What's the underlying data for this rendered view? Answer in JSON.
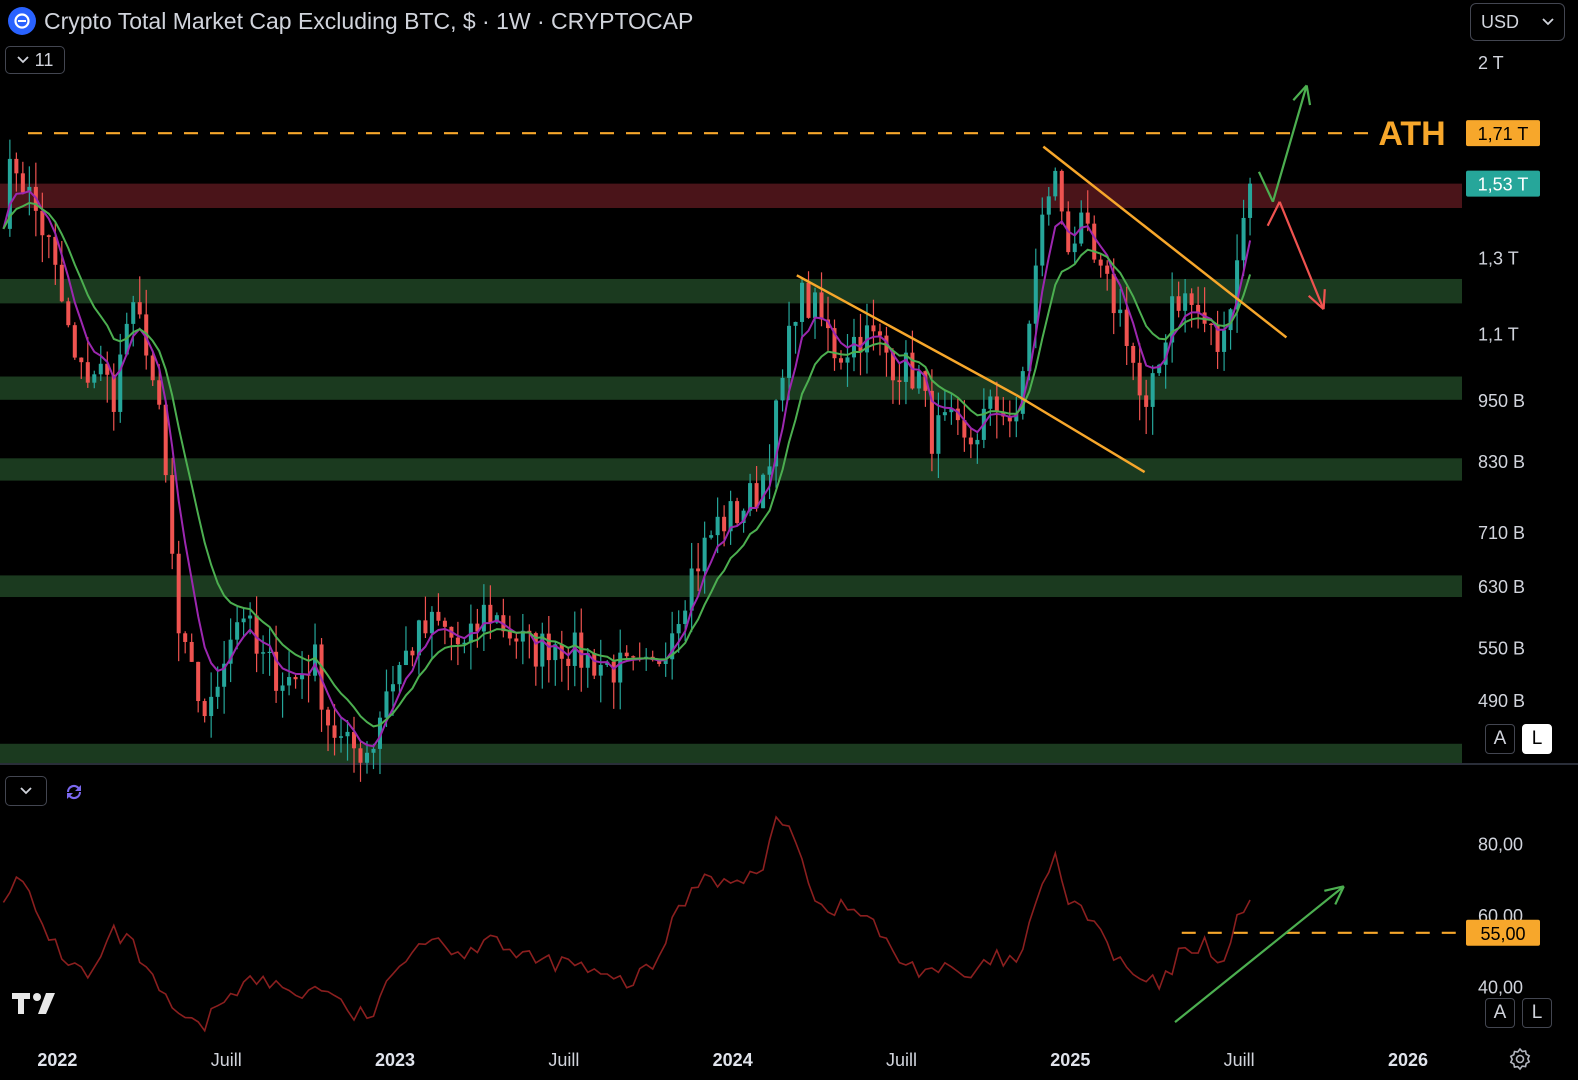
{
  "header": {
    "title": "Crypto Total Market Cap Excluding BTC, $ · 1W · CRYPTOCAP",
    "indicator_count": "11",
    "currency": "USD"
  },
  "scale_buttons": {
    "auto": "A",
    "log": "L"
  },
  "colors": {
    "up": "#26a69a",
    "down": "#ef5350",
    "ema_fast": "#9c27b0",
    "ema_slow": "#4caf50",
    "trendline": "#f7a72b",
    "ath": "#f7a72b",
    "rsi": "#8b1f1f",
    "support_zone": "#1b3a1f",
    "resistance_zone": "#4a1419"
  },
  "chart_data": [
    {
      "type": "candlestick",
      "title": "Crypto Total Market Cap Excluding BTC, $ · 1W · CRYPTOCAP",
      "scale": "log",
      "ylim": [
        420,
        2100
      ],
      "y_ticks": [
        {
          "value": 2000,
          "label": "2 T"
        },
        {
          "value": 1300,
          "label": "1,3 T"
        },
        {
          "value": 1100,
          "label": "1,1 T"
        },
        {
          "value": 950,
          "label": "950 B"
        },
        {
          "value": 830,
          "label": "830 B"
        },
        {
          "value": 710,
          "label": "710 B"
        },
        {
          "value": 630,
          "label": "630 B"
        },
        {
          "value": 550,
          "label": "550 B"
        },
        {
          "value": 490,
          "label": "490 B"
        }
      ],
      "x_ticks": [
        "2022",
        "Juill",
        "2023",
        "Juill",
        "2024",
        "Juill",
        "2025",
        "Juill",
        "2026"
      ],
      "x_tick_years": [
        2022.0,
        2022.5,
        2023.0,
        2023.5,
        2024.0,
        2024.5,
        2025.0,
        2025.5,
        2026.0
      ],
      "xlim": [
        2021.83,
        2026.16
      ],
      "anchor_closes": [
        [
          2021.84,
          1450
        ],
        [
          2021.87,
          1620
        ],
        [
          2021.92,
          1480
        ],
        [
          2021.97,
          1350
        ],
        [
          2022.02,
          1150
        ],
        [
          2022.06,
          1000
        ],
        [
          2022.12,
          1020
        ],
        [
          2022.17,
          960
        ],
        [
          2022.21,
          1150
        ],
        [
          2022.26,
          1100
        ],
        [
          2022.31,
          870
        ],
        [
          2022.36,
          560
        ],
        [
          2022.41,
          500
        ],
        [
          2022.45,
          470
        ],
        [
          2022.5,
          560
        ],
        [
          2022.55,
          600
        ],
        [
          2022.59,
          540
        ],
        [
          2022.65,
          520
        ],
        [
          2022.7,
          510
        ],
        [
          2022.76,
          540
        ],
        [
          2022.8,
          470
        ],
        [
          2022.85,
          440
        ],
        [
          2022.93,
          440
        ],
        [
          2022.97,
          500
        ],
        [
          2023.06,
          560
        ],
        [
          2023.12,
          580
        ],
        [
          2023.21,
          545
        ],
        [
          2023.27,
          600
        ],
        [
          2023.34,
          570
        ],
        [
          2023.41,
          545
        ],
        [
          2023.47,
          560
        ],
        [
          2023.55,
          540
        ],
        [
          2023.62,
          530
        ],
        [
          2023.7,
          520
        ],
        [
          2023.76,
          520
        ],
        [
          2023.82,
          580
        ],
        [
          2023.88,
          650
        ],
        [
          2023.95,
          720
        ],
        [
          2024.01,
          740
        ],
        [
          2024.08,
          780
        ],
        [
          2024.14,
          950
        ],
        [
          2024.19,
          1200
        ],
        [
          2024.25,
          1150
        ],
        [
          2024.31,
          1050
        ],
        [
          2024.38,
          1100
        ],
        [
          2024.43,
          1080
        ],
        [
          2024.48,
          1030
        ],
        [
          2024.55,
          1000
        ],
        [
          2024.59,
          880
        ],
        [
          2024.64,
          900
        ],
        [
          2024.69,
          850
        ],
        [
          2024.75,
          920
        ],
        [
          2024.8,
          940
        ],
        [
          2024.84,
          890
        ],
        [
          2024.88,
          1150
        ],
        [
          2024.93,
          1500
        ],
        [
          2024.96,
          1550
        ],
        [
          2024.99,
          1350
        ],
        [
          2025.04,
          1380
        ],
        [
          2025.08,
          1250
        ],
        [
          2025.13,
          1180
        ],
        [
          2025.17,
          1100
        ],
        [
          2025.22,
          900
        ],
        [
          2025.27,
          1050
        ],
        [
          2025.3,
          1200
        ],
        [
          2025.35,
          1180
        ],
        [
          2025.4,
          1120
        ],
        [
          2025.45,
          1050
        ],
        [
          2025.48,
          1250
        ],
        [
          2025.52,
          1450
        ],
        [
          2025.54,
          1530
        ]
      ],
      "series": [
        {
          "name": "",
          "kind": "ema_fast",
          "period": 5
        },
        {
          "name": "",
          "kind": "ema_slow",
          "period": 11
        }
      ],
      "horizontal_zones": [
        {
          "kind": "resistance",
          "low": 1450,
          "high": 1530
        },
        {
          "kind": "support",
          "low": 1175,
          "high": 1240
        },
        {
          "kind": "support",
          "low": 950,
          "high": 1000
        },
        {
          "kind": "support",
          "low": 795,
          "high": 835
        },
        {
          "kind": "support",
          "low": 615,
          "high": 645
        },
        {
          "kind": "support",
          "low": 425,
          "high": 445
        }
      ],
      "trendlines": [
        {
          "from": [
            2024.19,
            1250
          ],
          "to": [
            2024.84,
            960
          ]
        },
        {
          "from": [
            2024.84,
            960
          ],
          "to": [
            2025.22,
            810
          ]
        },
        {
          "from": [
            2024.92,
            1660
          ],
          "to": [
            2025.64,
            1090
          ]
        }
      ],
      "annotations": [
        {
          "kind": "hline-dashed",
          "value": 1710,
          "label": "ATH",
          "price_label": "1,71 T"
        },
        {
          "kind": "last-price",
          "value": 1530,
          "price_label": "1,53 T"
        },
        {
          "kind": "arrow-up",
          "from": [
            2025.6,
            1470
          ],
          "to": [
            2025.7,
            1900
          ]
        },
        {
          "kind": "arrow-down",
          "from": [
            2025.62,
            1470
          ],
          "to": [
            2025.75,
            1160
          ]
        }
      ]
    },
    {
      "type": "line",
      "title": "",
      "ylim": [
        25,
        100
      ],
      "y_ticks": [
        {
          "value": 80,
          "label": "80,00"
        },
        {
          "value": 60,
          "label": "60,00"
        },
        {
          "value": 40,
          "label": "40,00"
        }
      ],
      "anchor_values": [
        [
          2021.84,
          66
        ],
        [
          2021.89,
          70
        ],
        [
          2021.95,
          58
        ],
        [
          2022.02,
          48
        ],
        [
          2022.1,
          42
        ],
        [
          2022.16,
          55
        ],
        [
          2022.22,
          52
        ],
        [
          2022.3,
          38
        ],
        [
          2022.38,
          30
        ],
        [
          2022.43,
          28
        ],
        [
          2022.5,
          38
        ],
        [
          2022.58,
          42
        ],
        [
          2022.65,
          40
        ],
        [
          2022.72,
          38
        ],
        [
          2022.8,
          40
        ],
        [
          2022.86,
          32
        ],
        [
          2022.93,
          32
        ],
        [
          2022.98,
          40
        ],
        [
          2023.05,
          52
        ],
        [
          2023.12,
          54
        ],
        [
          2023.21,
          48
        ],
        [
          2023.28,
          56
        ],
        [
          2023.36,
          48
        ],
        [
          2023.45,
          47
        ],
        [
          2023.54,
          46
        ],
        [
          2023.62,
          42
        ],
        [
          2023.7,
          41
        ],
        [
          2023.77,
          46
        ],
        [
          2023.84,
          62
        ],
        [
          2023.92,
          72
        ],
        [
          2024.0,
          68
        ],
        [
          2024.08,
          72
        ],
        [
          2024.14,
          88
        ],
        [
          2024.19,
          82
        ],
        [
          2024.25,
          62
        ],
        [
          2024.32,
          62
        ],
        [
          2024.4,
          60
        ],
        [
          2024.48,
          48
        ],
        [
          2024.55,
          45
        ],
        [
          2024.62,
          45
        ],
        [
          2024.7,
          42
        ],
        [
          2024.78,
          48
        ],
        [
          2024.84,
          46
        ],
        [
          2024.9,
          62
        ],
        [
          2024.95,
          78
        ],
        [
          2025.0,
          62
        ],
        [
          2025.06,
          60
        ],
        [
          2025.13,
          48
        ],
        [
          2025.2,
          42
        ],
        [
          2025.27,
          40
        ],
        [
          2025.33,
          50
        ],
        [
          2025.4,
          52
        ],
        [
          2025.46,
          46
        ],
        [
          2025.5,
          60
        ],
        [
          2025.54,
          67
        ]
      ],
      "annotations": [
        {
          "kind": "hline-dashed",
          "value": 55,
          "price_label": "55,00",
          "from_year": 2025.33
        },
        {
          "kind": "arrow-up",
          "from": [
            2025.31,
            30
          ],
          "to": [
            2025.81,
            68
          ]
        }
      ]
    }
  ]
}
